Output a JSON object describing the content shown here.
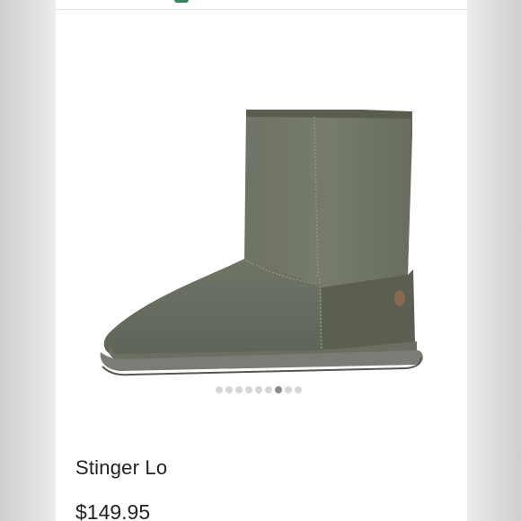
{
  "listing": {
    "title": "Stinger Lo",
    "price": "$149.95",
    "image_icon": "boot-image",
    "image_color": "#6b7062"
  },
  "carousel": {
    "count": 9,
    "active_index": 6
  },
  "colors": {
    "accent": "#2e8b57",
    "boot_suede": "#6b7062",
    "sole": "#7a7d75"
  }
}
